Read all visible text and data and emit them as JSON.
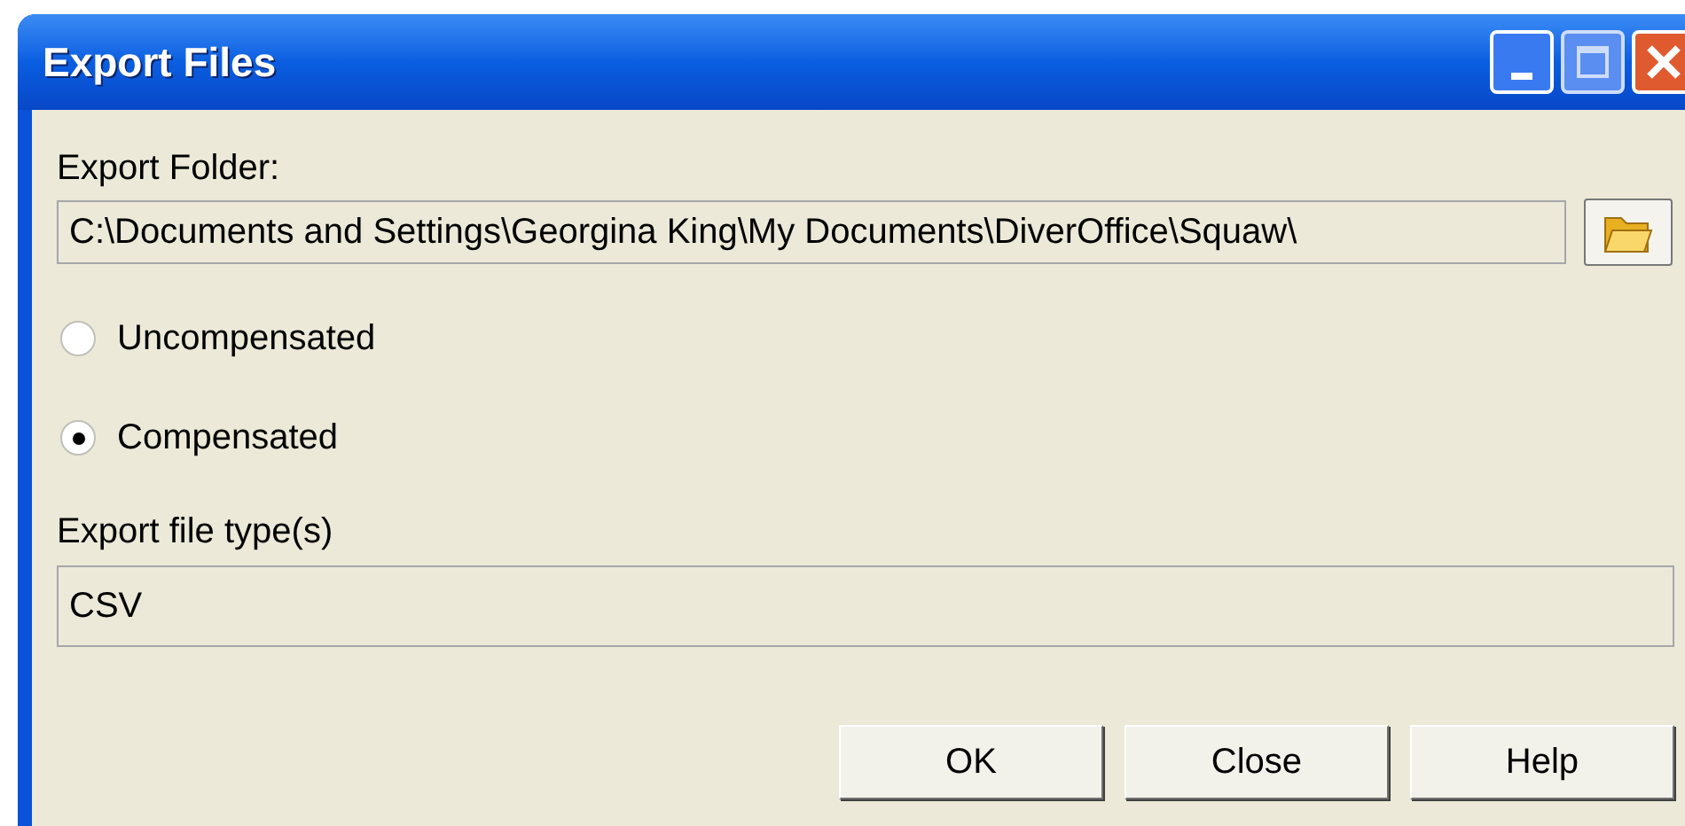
{
  "window": {
    "title": "Export Files"
  },
  "export_folder": {
    "label": "Export Folder:",
    "value": "C:\\Documents and Settings\\Georgina King\\My Documents\\DiverOffice\\Squaw\\"
  },
  "options": [
    {
      "label": "Uncompensated",
      "selected": false
    },
    {
      "label": "Compensated",
      "selected": true
    }
  ],
  "file_types": {
    "label": "Export file type(s)",
    "value": "CSV"
  },
  "buttons": [
    "OK",
    "Close",
    "Help"
  ]
}
